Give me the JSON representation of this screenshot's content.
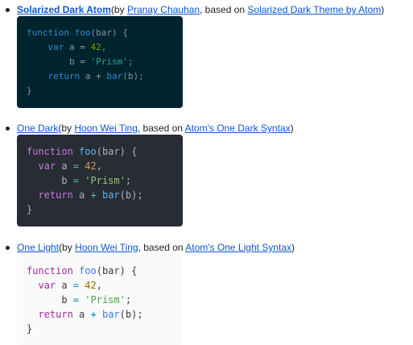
{
  "themes": [
    {
      "name": "Solarized Dark Atom",
      "by_prefix": "(by ",
      "author": "Pranay Chauhan",
      "based_prefix": ", based on ",
      "based_on": "Solarized Dark Theme by Atom",
      "suffix": ")",
      "code": {
        "l1_kw": "function",
        "l1_fn": "foo",
        "l1_rest": "(bar) {",
        "l2_kw": "var",
        "l2_a": " a ",
        "l2_eq": "=",
        "l2_num": "42",
        "l2_end": ",",
        "l3_b": "b ",
        "l3_eq": "=",
        "l3_str": "'Prism'",
        "l3_end": ";",
        "l4_kw": "return",
        "l4_a": " a ",
        "l4_op": "+",
        "l4_fn": "bar",
        "l4_rest": "(b);",
        "l5": "}"
      }
    },
    {
      "name": "One Dark",
      "by_prefix": "(by ",
      "author": "Hoon Wei Ting",
      "based_prefix": ", based on ",
      "based_on": "Atom's One Dark Syntax",
      "suffix": ")",
      "code": {
        "l1_kw": "function",
        "l1_fn": "foo",
        "l1_rest": "(bar) {",
        "l2_kw": "var",
        "l2_a": " a ",
        "l2_eq": "=",
        "l2_num": "42",
        "l2_end": ",",
        "l3_b": "b ",
        "l3_eq": "=",
        "l3_str": "'Prism'",
        "l3_end": ";",
        "l4_kw": "return",
        "l4_a": " a ",
        "l4_op": "+",
        "l4_fn": "bar",
        "l4_rest": "(b);",
        "l5": "}"
      }
    },
    {
      "name": "One Light",
      "by_prefix": "(by ",
      "author": "Hoon Wei Ting",
      "based_prefix": ", based on ",
      "based_on": "Atom's One Light Syntax",
      "suffix": ")",
      "code": {
        "l1_kw": "function",
        "l1_fn": "foo",
        "l1_rest": "(bar) {",
        "l2_kw": "var",
        "l2_a": " a ",
        "l2_eq": "=",
        "l2_num": "42",
        "l2_end": ",",
        "l3_b": "b ",
        "l3_eq": "=",
        "l3_str": "'Prism'",
        "l3_end": ";",
        "l4_kw": "return",
        "l4_a": " a ",
        "l4_op": "+",
        "l4_fn": "bar",
        "l4_rest": "(b);",
        "l5": "}"
      }
    }
  ],
  "colors": {
    "link": "#0b57d0",
    "solarized_bg": "#00242e",
    "one_dark_bg": "#282c34",
    "one_light_bg": "#fafafa"
  }
}
